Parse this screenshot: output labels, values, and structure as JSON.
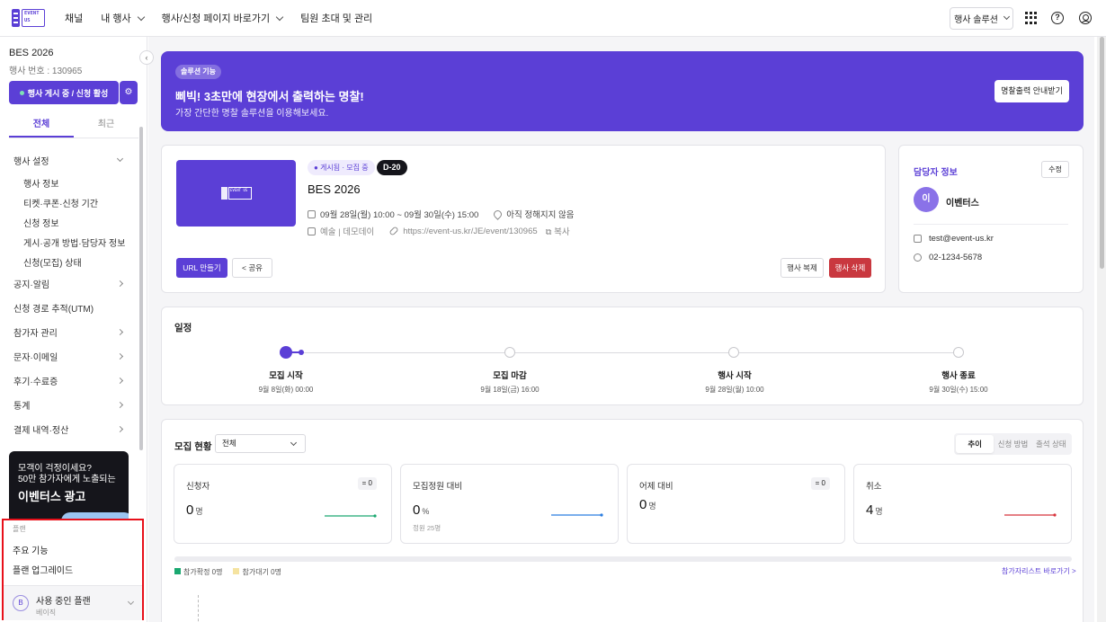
{
  "topbar": {
    "logo_text": "EVENT US",
    "nav": [
      "채널",
      "내 행사",
      "행사/신청 페이지 바로가기",
      "팀원 초대 및 관리"
    ],
    "solution_button": "행사 솔루션"
  },
  "sidebar": {
    "event_title": "BES 2026",
    "event_number": "행사 번호 : 130965",
    "active_button": "행사 게시 중 / 신청 활성",
    "tabs": [
      "전체",
      "최근"
    ],
    "menu": {
      "settings": "행사 설정",
      "settings_items": [
        "행사 정보",
        "티켓·쿠폰·신청 기간",
        "신청 정보",
        "게시·공개 방법·담당자 정보",
        "신청(모집) 상태"
      ],
      "items": [
        "공지·알림",
        "신청 경로 추적(UTM)",
        "참가자 관리",
        "문자·이메일",
        "후기·수료증",
        "통계",
        "결제 내역·정산"
      ]
    },
    "ad": {
      "line1": "모객이 걱정이세요?",
      "line2": "50만 참가자에게 노출되는",
      "headline": "이벤터스 광고"
    },
    "plan": {
      "heading": "플랜",
      "items": [
        "주요 기능",
        "플랜 업그레이드"
      ],
      "current_avatar": "B",
      "current_label": "사용 중인 플랜",
      "current_plan": "베이직"
    }
  },
  "banner": {
    "tag": "솔루션 기능",
    "headline": "삐빅! 3초만에 현장에서 출력하는 명찰!",
    "sub": "가장 간단한 명찰 솔루션을 이용해보세요.",
    "button": "명찰출력 안내받기"
  },
  "event": {
    "status": "게시됨 · 모집 중",
    "dday": "D-20",
    "title": "BES 2026",
    "datetime": "09월 28일(월) 10:00 ~ 09월 30일(수) 15:00",
    "location": "아직 정해지지 않음",
    "category": "예술 | 데모데이",
    "url": "https://event-us.kr/JE/event/130965",
    "copy": "복사",
    "buttons": {
      "url": "URL 만들기",
      "share": "공유",
      "duplicate": "행사 복제",
      "delete": "행사 삭제"
    }
  },
  "manager": {
    "title": "담당자 정보",
    "edit": "수정",
    "avatar": "이",
    "name": "이벤터스",
    "email": "test@event-us.kr",
    "phone": "02-1234-5678"
  },
  "schedule": {
    "title": "일정",
    "steps": [
      {
        "label": "모집 시작",
        "date": "9월 8일(화) 00:00"
      },
      {
        "label": "모집 마감",
        "date": "9월 18일(금) 16:00"
      },
      {
        "label": "행사 시작",
        "date": "9월 28일(월) 10:00"
      },
      {
        "label": "행사 종료",
        "date": "9월 30일(수) 15:00"
      }
    ],
    "current_step": 0
  },
  "recruit": {
    "title": "모집 현황",
    "filter": "전체",
    "tabs": [
      "추이",
      "신청 방법",
      "출석 상태"
    ],
    "stats": [
      {
        "label": "신청자",
        "value": "0",
        "unit": "명",
        "badge": "= 0",
        "sub": "",
        "color": "#1aa870"
      },
      {
        "label": "모집정원 대비",
        "value": "0",
        "unit": "%",
        "badge": "",
        "sub": "정원 25명",
        "color": "#2b7de0"
      },
      {
        "label": "어제 대비",
        "value": "0",
        "unit": "명",
        "badge": "= 0",
        "sub": "",
        "color": ""
      },
      {
        "label": "취소",
        "value": "4",
        "unit": "명",
        "badge": "",
        "sub": "",
        "color": "#d8343c"
      }
    ],
    "legend": [
      {
        "label": "참가확정 0명",
        "color": "#1aa870"
      },
      {
        "label": "참가대기 0명",
        "color": "#f5e3a0"
      }
    ],
    "list_link": "참가자리스트 바로가기 >"
  }
}
